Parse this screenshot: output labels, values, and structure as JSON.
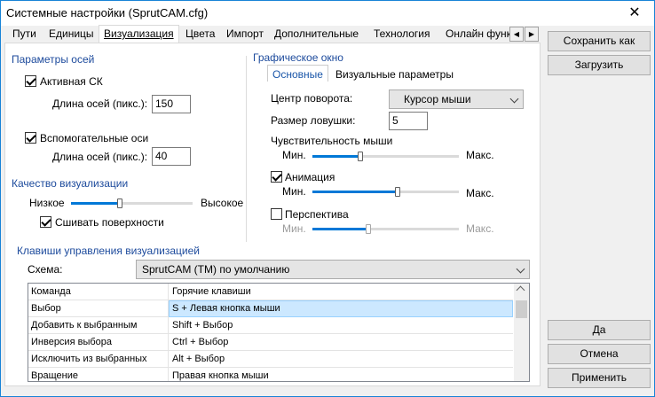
{
  "window": {
    "title": "Системные настройки (SprutCAM.cfg)"
  },
  "tabs": [
    {
      "label": "Пути"
    },
    {
      "label": "Единицы"
    },
    {
      "label": "Визуализация"
    },
    {
      "label": "Цвета"
    },
    {
      "label": "Импорт"
    },
    {
      "label": "Дополнительные"
    },
    {
      "label": "Технология"
    },
    {
      "label": "Онлайн функ"
    }
  ],
  "axes": {
    "group_title": "Параметры осей",
    "active_cs_label": "Активная СК",
    "active_cs_checked": true,
    "axis_len_label_1": "Длина осей (пикс.):",
    "axis_len_value_1": "150",
    "aux_axes_label": "Вспомогательные оси",
    "aux_axes_checked": true,
    "axis_len_label_2": "Длина осей (пикс.):",
    "axis_len_value_2": "40"
  },
  "quality": {
    "group_title": "Качество визуализации",
    "low_label": "Низкое",
    "high_label": "Высокое",
    "slider_value": 0.4,
    "stitch_label": "Сшивать поверхности",
    "stitch_checked": true
  },
  "graphics": {
    "group_title": "Графическое окно",
    "subtab_basic": "Основные",
    "subtab_visual": "Визуальные параметры",
    "pivot_label": "Центр поворота:",
    "pivot_value": "Курсор мыши",
    "trap_label": "Размер ловушки:",
    "trap_value": "5",
    "sensitivity_label": "Чувствительность мыши",
    "min_label": "Мин.",
    "max_label": "Макс.",
    "sensitivity_value": 0.33,
    "animation_label": "Анимация",
    "animation_checked": true,
    "animation_value": 0.58,
    "perspective_label": "Перспектива",
    "perspective_checked": false,
    "perspective_value": 0.38
  },
  "keys": {
    "group_title": "Клавиши управления визуализацией",
    "scheme_label": "Схема:",
    "scheme_value": "SprutCAM (TM) по умолчанию",
    "header": {
      "command": "Команда",
      "hotkeys": "Горячие клавиши"
    },
    "rows": [
      {
        "command": "Выбор",
        "hotkeys": "S + Левая кнопка мыши"
      },
      {
        "command": "Добавить к выбранным",
        "hotkeys": "Shift + Выбор"
      },
      {
        "command": "Инверсия выбора",
        "hotkeys": "Ctrl + Выбор"
      },
      {
        "command": "Исключить из выбранных",
        "hotkeys": "Alt + Выбор"
      },
      {
        "command": "Вращение",
        "hotkeys": "Правая кнопка мыши"
      }
    ]
  },
  "buttons": {
    "save_as": "Сохранить как",
    "load": "Загрузить",
    "ok": "Да",
    "cancel": "Отмена",
    "apply": "Применить"
  },
  "colors": {
    "accent": "#0078d7",
    "group_title": "#1c4a9c",
    "selection": "#cce8ff"
  }
}
